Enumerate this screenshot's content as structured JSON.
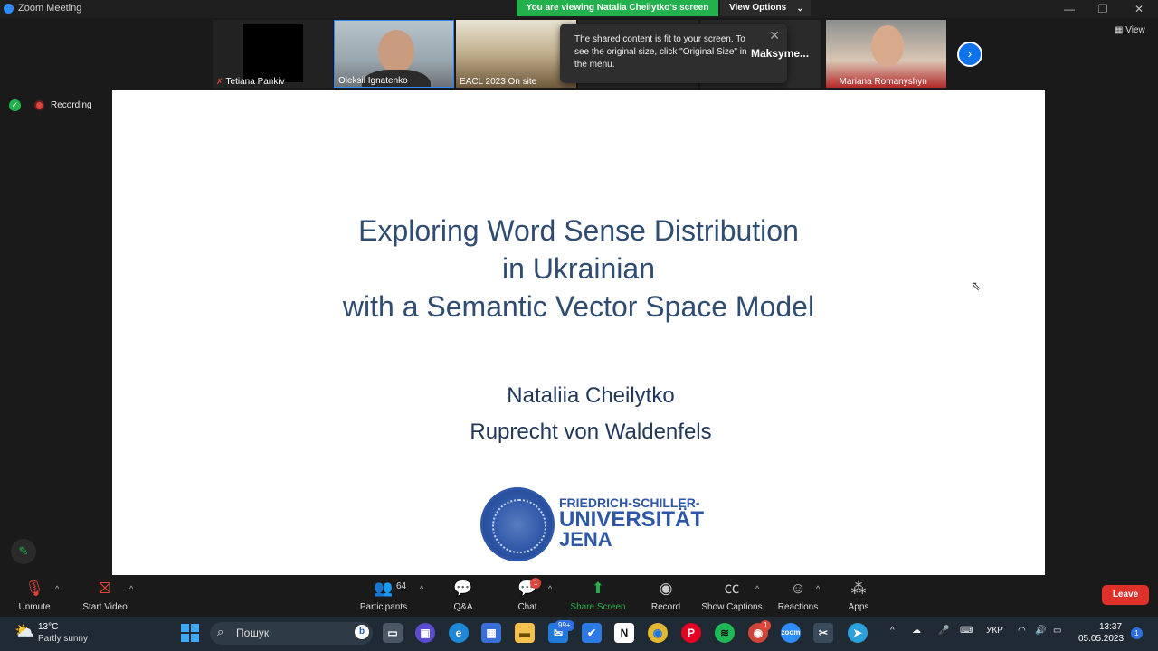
{
  "window": {
    "title": "Zoom Meeting"
  },
  "banner": {
    "viewing": "You are viewing Natalia Cheilytko's screen",
    "view_options": "View Options"
  },
  "participants_strip": [
    {
      "name": "Tetiana Pankiv",
      "muted": true
    },
    {
      "name": "Oleksii Ignatenko",
      "muted": false
    },
    {
      "name": "EACL 2023 On site",
      "muted": false
    },
    {
      "name": "Maksyme...",
      "muted": false
    },
    {
      "name": "Mariana Romanyshyn",
      "muted": true
    }
  ],
  "view_button": "View",
  "tooltip": {
    "text": "The shared content is fit to your screen. To see the original size, click \"Original Size\" in the menu."
  },
  "recording": {
    "label": "Recording"
  },
  "slide": {
    "title_lines": [
      "Exploring Word Sense Distribution",
      "in Ukrainian",
      "with a Semantic Vector Space Model"
    ],
    "authors": [
      "Nataliia Cheilytko",
      "Ruprecht von Waldenfels"
    ],
    "logo_lines": [
      "FRIEDRICH-SCHILLER-",
      "UNIVERSITÄT",
      "JENA"
    ]
  },
  "toolbar": {
    "unmute": "Unmute",
    "start_video": "Start Video",
    "participants": "Participants",
    "participants_count": "64",
    "qa": "Q&A",
    "chat": "Chat",
    "chat_badge": "1",
    "share_screen": "Share Screen",
    "record": "Record",
    "show_captions": "Show Captions",
    "reactions": "Reactions",
    "apps": "Apps",
    "leave": "Leave"
  },
  "taskbar": {
    "weather_temp": "13°C",
    "weather_desc": "Partly sunny",
    "search_placeholder": "Пошук",
    "mail_badge": "99+",
    "chrome_badge": "1",
    "language": "УКР",
    "time": "13:37",
    "date": "05.05.2023"
  },
  "colors": {
    "accent": "#2d8cff",
    "share_green": "#22b14c",
    "leave_red": "#e0302a",
    "slide_title": "#2f4d72",
    "logo_blue": "#2e57a8"
  }
}
